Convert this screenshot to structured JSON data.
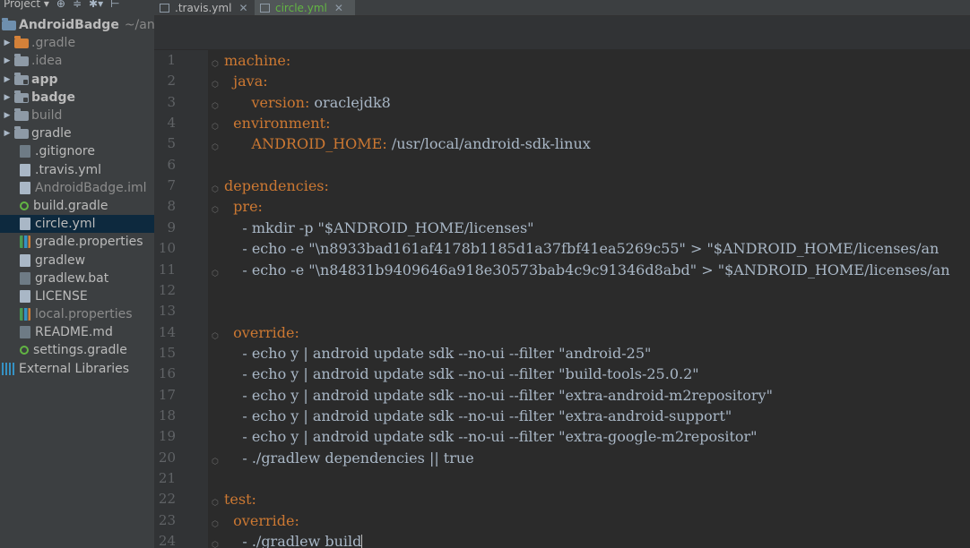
{
  "toolbar": {
    "project_label": "Project",
    "icons": [
      "chevron-down-icon",
      "target-icon",
      "collapse-icon",
      "gear-icon",
      "hide-icon"
    ]
  },
  "tree": {
    "root_name": "AndroidBadge",
    "root_path": "~/andro",
    "items": [
      {
        "label": ".gradle",
        "kind": "folder-orange",
        "expandable": true,
        "muted": true
      },
      {
        "label": ".idea",
        "kind": "folder",
        "expandable": true,
        "muted": true
      },
      {
        "label": "app",
        "kind": "folder-module",
        "expandable": true,
        "bold": true
      },
      {
        "label": "badge",
        "kind": "folder-module",
        "expandable": true,
        "bold": true
      },
      {
        "label": "build",
        "kind": "folder",
        "expandable": true,
        "muted": true
      },
      {
        "label": "gradle",
        "kind": "folder",
        "expandable": true
      },
      {
        "label": ".gitignore",
        "kind": "file-dark"
      },
      {
        "label": ".travis.yml",
        "kind": "file"
      },
      {
        "label": "AndroidBadge.iml",
        "kind": "file",
        "muted": true
      },
      {
        "label": "build.gradle",
        "kind": "file-gradle"
      },
      {
        "label": "circle.yml",
        "kind": "file",
        "selected": true
      },
      {
        "label": "gradle.properties",
        "kind": "file-bars"
      },
      {
        "label": "gradlew",
        "kind": "file"
      },
      {
        "label": "gradlew.bat",
        "kind": "file-dark"
      },
      {
        "label": "LICENSE",
        "kind": "file"
      },
      {
        "label": "local.properties",
        "kind": "file-bars",
        "muted": true
      },
      {
        "label": "README.md",
        "kind": "file-dark"
      },
      {
        "label": "settings.gradle",
        "kind": "file-gradle"
      }
    ],
    "external_libraries": "External Libraries"
  },
  "tabs": [
    {
      "label": ".travis.yml",
      "active": false
    },
    {
      "label": "circle.yml",
      "active": true
    }
  ],
  "editor": {
    "lines": [
      {
        "n": "1",
        "key": "machine:",
        "rest": ""
      },
      {
        "n": "2",
        "key": "  java:",
        "rest": ""
      },
      {
        "n": "3",
        "key": "      version:",
        "rest": " oraclejdk8"
      },
      {
        "n": "4",
        "key": "  environment:",
        "rest": ""
      },
      {
        "n": "5",
        "key": "      ANDROID_HOME:",
        "rest": " /usr/local/android-sdk-linux"
      },
      {
        "n": "6",
        "key": "",
        "rest": ""
      },
      {
        "n": "7",
        "key": "dependencies:",
        "rest": ""
      },
      {
        "n": "8",
        "key": "  pre:",
        "rest": ""
      },
      {
        "n": "9",
        "key": "",
        "rest": "    - mkdir -p \"$ANDROID_HOME/licenses\""
      },
      {
        "n": "10",
        "key": "",
        "rest": "    - echo -e \"\\n8933bad161af4178b1185d1a37fbf41ea5269c55\" > \"$ANDROID_HOME/licenses/an"
      },
      {
        "n": "11",
        "key": "",
        "rest": "    - echo -e \"\\n84831b9409646a918e30573bab4c9c91346d8abd\" > \"$ANDROID_HOME/licenses/an"
      },
      {
        "n": "12",
        "key": "",
        "rest": ""
      },
      {
        "n": "13",
        "key": "",
        "rest": ""
      },
      {
        "n": "14",
        "key": "  override:",
        "rest": ""
      },
      {
        "n": "15",
        "key": "",
        "rest": "    - echo y | android update sdk --no-ui --filter \"android-25\""
      },
      {
        "n": "16",
        "key": "",
        "rest": "    - echo y | android update sdk --no-ui --filter \"build-tools-25.0.2\""
      },
      {
        "n": "17",
        "key": "",
        "rest": "    - echo y | android update sdk --no-ui --filter \"extra-android-m2repository\""
      },
      {
        "n": "18",
        "key": "",
        "rest": "    - echo y | android update sdk --no-ui --filter \"extra-android-support\""
      },
      {
        "n": "19",
        "key": "",
        "rest": "    - echo y | android update sdk --no-ui --filter \"extra-google-m2repositor\""
      },
      {
        "n": "20",
        "key": "",
        "rest": "    - ./gradlew dependencies || true"
      },
      {
        "n": "21",
        "key": "",
        "rest": ""
      },
      {
        "n": "22",
        "key": "test:",
        "rest": ""
      },
      {
        "n": "23",
        "key": "  override:",
        "rest": ""
      },
      {
        "n": "24",
        "key": "",
        "rest": "    - ./gradlew build"
      }
    ]
  },
  "colors": {
    "editor_bg": "#2b2b2b",
    "sidebar_bg": "#3c3f41",
    "key_orange": "#cc7832",
    "text": "#a9b7c6",
    "active_tab_green": "#62b543",
    "selection": "#0d293e"
  }
}
